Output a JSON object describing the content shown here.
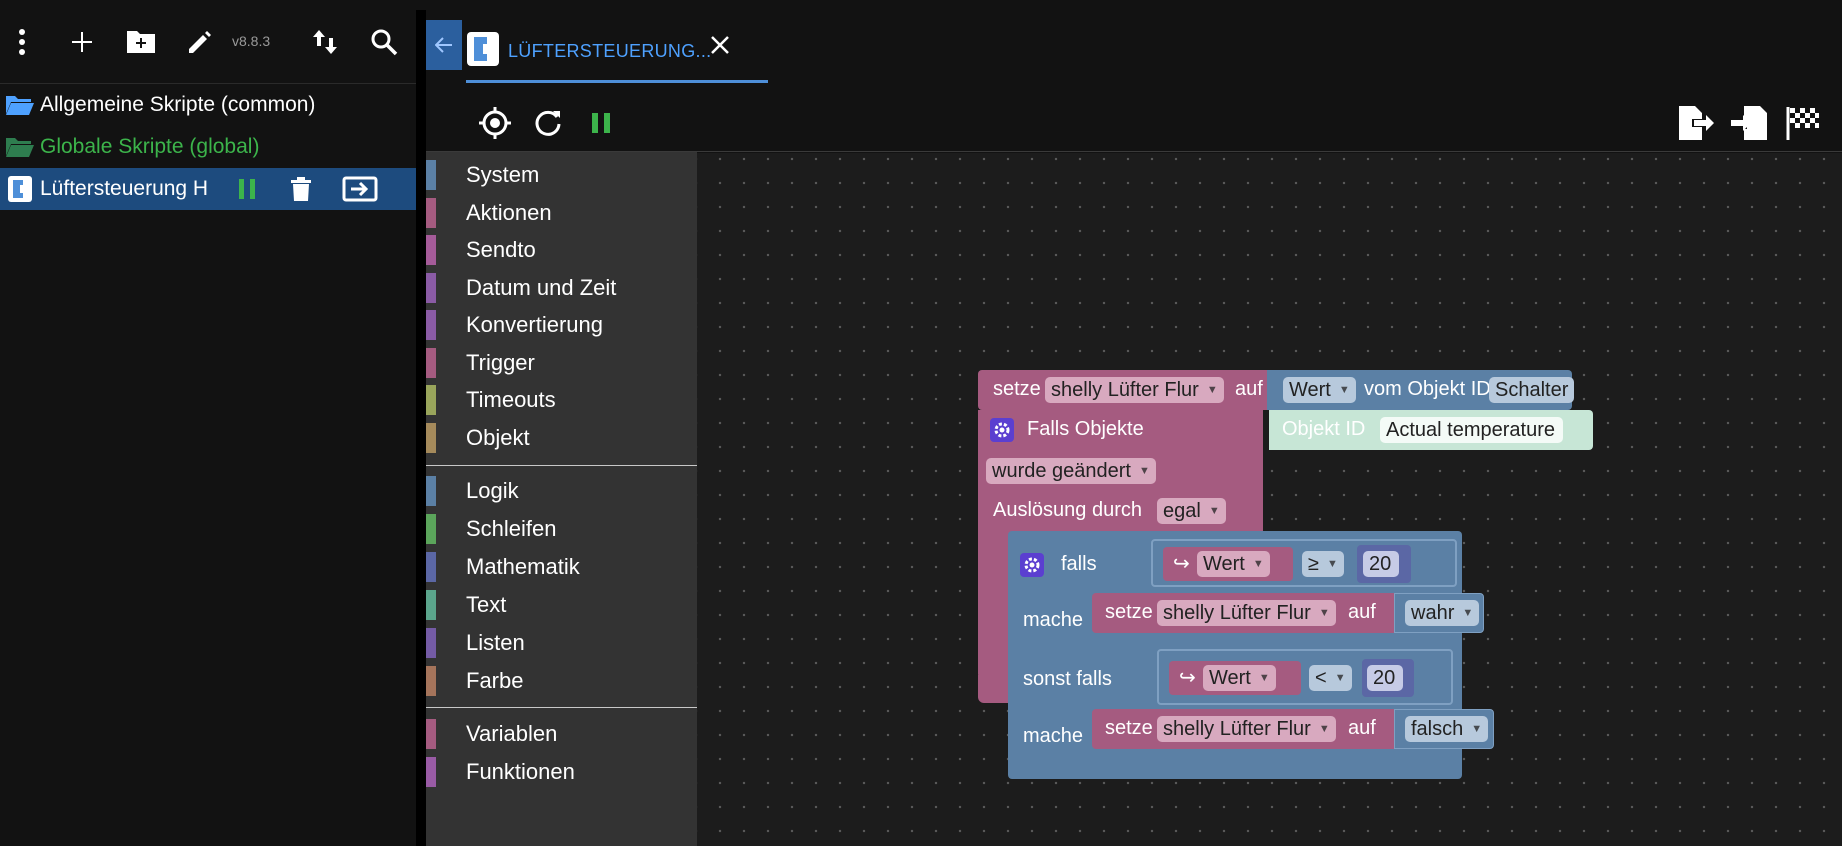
{
  "sidebar": {
    "version": "v8.8.3",
    "toolbar_icons": [
      "more-vert-icon",
      "add-icon",
      "new-folder-icon",
      "edit-icon",
      "sort-icon",
      "search-icon"
    ],
    "items": [
      {
        "label": "Allgemeine Skripte (common)",
        "color": "#ffffff",
        "icon": "folder-open-icon"
      },
      {
        "label": "Globale Skripte (global)",
        "color": "#3cb44b",
        "icon": "folder-open-icon"
      },
      {
        "label": "Lüftersteuerung H",
        "color": "#ffffff",
        "icon": "blockly-script-icon"
      }
    ]
  },
  "tab": {
    "title": "LÜFTERSTEUERUNG..."
  },
  "toolbox": {
    "group1": [
      {
        "label": "System",
        "color": "#5b80a5"
      },
      {
        "label": "Aktionen",
        "color": "#a55b80"
      },
      {
        "label": "Sendto",
        "color": "#a55b99"
      },
      {
        "label": "Datum und Zeit",
        "color": "#8a5ba5"
      },
      {
        "label": "Konvertierung",
        "color": "#8a5ba5"
      },
      {
        "label": "Trigger",
        "color": "#a55b80"
      },
      {
        "label": "Timeouts",
        "color": "#99a55b"
      },
      {
        "label": "Objekt",
        "color": "#a58a5b"
      }
    ],
    "group2": [
      {
        "label": "Logik",
        "color": "#5b80a5"
      },
      {
        "label": "Schleifen",
        "color": "#5ba55b"
      },
      {
        "label": "Mathematik",
        "color": "#5b67a5"
      },
      {
        "label": "Text",
        "color": "#5ba58c"
      },
      {
        "label": "Listen",
        "color": "#745ba5"
      },
      {
        "label": "Farbe",
        "color": "#a5745b"
      }
    ],
    "group3": [
      {
        "label": "Variablen",
        "color": "#a55b80"
      },
      {
        "label": "Funktionen",
        "color": "#995ba5"
      }
    ]
  },
  "blocks": {
    "setze1": {
      "word": "setze",
      "var": "shelly Lüfter Flur",
      "auf": "auf",
      "value_dd": "Wert",
      "vom": "vom Objekt ID",
      "obj": "Schalter"
    },
    "trigger": {
      "falls_objekte": "Falls Objekte",
      "objekt_id": "Objekt ID",
      "objekt_name": "Actual temperature",
      "mode": "wurde geändert",
      "ausloesung": "Auslösung durch",
      "ausloesung_val": "egal"
    },
    "if": {
      "falls": "falls",
      "mache": "mache",
      "sonst_falls": "sonst falls",
      "cond1": {
        "var": "Wert",
        "op": "≥",
        "num": "20"
      },
      "action1": {
        "setze": "setze",
        "var": "shelly Lüfter Flur",
        "auf": "auf",
        "val": "wahr"
      },
      "cond2": {
        "var": "Wert",
        "op": "<",
        "num": "20"
      },
      "action2": {
        "setze": "setze",
        "var": "shelly Lüfter Flur",
        "auf": "auf",
        "val": "falsch"
      }
    }
  },
  "colors": {
    "accent": "#4ea1ff",
    "selected_row": "#1d4b7e",
    "trigger_block": "#a55b80",
    "logic_block": "#5b80a5",
    "pause_green": "#3cb44b"
  }
}
